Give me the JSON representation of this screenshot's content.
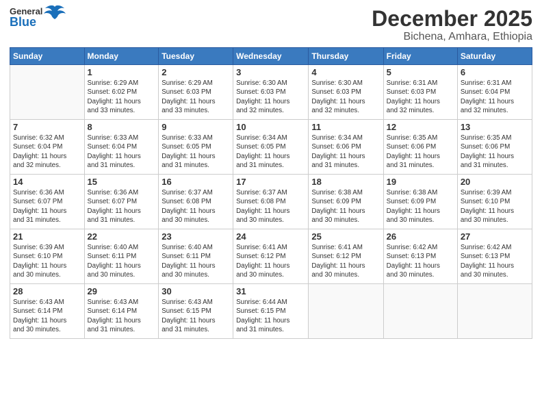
{
  "header": {
    "logo": {
      "general": "General",
      "blue": "Blue"
    },
    "title": "December 2025",
    "subtitle": "Bichena, Amhara, Ethiopia"
  },
  "weekdays": [
    "Sunday",
    "Monday",
    "Tuesday",
    "Wednesday",
    "Thursday",
    "Friday",
    "Saturday"
  ],
  "weeks": [
    [
      {
        "day": "",
        "info": ""
      },
      {
        "day": "1",
        "info": "Sunrise: 6:29 AM\nSunset: 6:02 PM\nDaylight: 11 hours\nand 33 minutes."
      },
      {
        "day": "2",
        "info": "Sunrise: 6:29 AM\nSunset: 6:03 PM\nDaylight: 11 hours\nand 33 minutes."
      },
      {
        "day": "3",
        "info": "Sunrise: 6:30 AM\nSunset: 6:03 PM\nDaylight: 11 hours\nand 32 minutes."
      },
      {
        "day": "4",
        "info": "Sunrise: 6:30 AM\nSunset: 6:03 PM\nDaylight: 11 hours\nand 32 minutes."
      },
      {
        "day": "5",
        "info": "Sunrise: 6:31 AM\nSunset: 6:03 PM\nDaylight: 11 hours\nand 32 minutes."
      },
      {
        "day": "6",
        "info": "Sunrise: 6:31 AM\nSunset: 6:04 PM\nDaylight: 11 hours\nand 32 minutes."
      }
    ],
    [
      {
        "day": "7",
        "info": "Sunrise: 6:32 AM\nSunset: 6:04 PM\nDaylight: 11 hours\nand 32 minutes."
      },
      {
        "day": "8",
        "info": "Sunrise: 6:33 AM\nSunset: 6:04 PM\nDaylight: 11 hours\nand 31 minutes."
      },
      {
        "day": "9",
        "info": "Sunrise: 6:33 AM\nSunset: 6:05 PM\nDaylight: 11 hours\nand 31 minutes."
      },
      {
        "day": "10",
        "info": "Sunrise: 6:34 AM\nSunset: 6:05 PM\nDaylight: 11 hours\nand 31 minutes."
      },
      {
        "day": "11",
        "info": "Sunrise: 6:34 AM\nSunset: 6:06 PM\nDaylight: 11 hours\nand 31 minutes."
      },
      {
        "day": "12",
        "info": "Sunrise: 6:35 AM\nSunset: 6:06 PM\nDaylight: 11 hours\nand 31 minutes."
      },
      {
        "day": "13",
        "info": "Sunrise: 6:35 AM\nSunset: 6:06 PM\nDaylight: 11 hours\nand 31 minutes."
      }
    ],
    [
      {
        "day": "14",
        "info": "Sunrise: 6:36 AM\nSunset: 6:07 PM\nDaylight: 11 hours\nand 31 minutes."
      },
      {
        "day": "15",
        "info": "Sunrise: 6:36 AM\nSunset: 6:07 PM\nDaylight: 11 hours\nand 31 minutes."
      },
      {
        "day": "16",
        "info": "Sunrise: 6:37 AM\nSunset: 6:08 PM\nDaylight: 11 hours\nand 30 minutes."
      },
      {
        "day": "17",
        "info": "Sunrise: 6:37 AM\nSunset: 6:08 PM\nDaylight: 11 hours\nand 30 minutes."
      },
      {
        "day": "18",
        "info": "Sunrise: 6:38 AM\nSunset: 6:09 PM\nDaylight: 11 hours\nand 30 minutes."
      },
      {
        "day": "19",
        "info": "Sunrise: 6:38 AM\nSunset: 6:09 PM\nDaylight: 11 hours\nand 30 minutes."
      },
      {
        "day": "20",
        "info": "Sunrise: 6:39 AM\nSunset: 6:10 PM\nDaylight: 11 hours\nand 30 minutes."
      }
    ],
    [
      {
        "day": "21",
        "info": "Sunrise: 6:39 AM\nSunset: 6:10 PM\nDaylight: 11 hours\nand 30 minutes."
      },
      {
        "day": "22",
        "info": "Sunrise: 6:40 AM\nSunset: 6:11 PM\nDaylight: 11 hours\nand 30 minutes."
      },
      {
        "day": "23",
        "info": "Sunrise: 6:40 AM\nSunset: 6:11 PM\nDaylight: 11 hours\nand 30 minutes."
      },
      {
        "day": "24",
        "info": "Sunrise: 6:41 AM\nSunset: 6:12 PM\nDaylight: 11 hours\nand 30 minutes."
      },
      {
        "day": "25",
        "info": "Sunrise: 6:41 AM\nSunset: 6:12 PM\nDaylight: 11 hours\nand 30 minutes."
      },
      {
        "day": "26",
        "info": "Sunrise: 6:42 AM\nSunset: 6:13 PM\nDaylight: 11 hours\nand 30 minutes."
      },
      {
        "day": "27",
        "info": "Sunrise: 6:42 AM\nSunset: 6:13 PM\nDaylight: 11 hours\nand 30 minutes."
      }
    ],
    [
      {
        "day": "28",
        "info": "Sunrise: 6:43 AM\nSunset: 6:14 PM\nDaylight: 11 hours\nand 30 minutes."
      },
      {
        "day": "29",
        "info": "Sunrise: 6:43 AM\nSunset: 6:14 PM\nDaylight: 11 hours\nand 31 minutes."
      },
      {
        "day": "30",
        "info": "Sunrise: 6:43 AM\nSunset: 6:15 PM\nDaylight: 11 hours\nand 31 minutes."
      },
      {
        "day": "31",
        "info": "Sunrise: 6:44 AM\nSunset: 6:15 PM\nDaylight: 11 hours\nand 31 minutes."
      },
      {
        "day": "",
        "info": ""
      },
      {
        "day": "",
        "info": ""
      },
      {
        "day": "",
        "info": ""
      }
    ]
  ]
}
